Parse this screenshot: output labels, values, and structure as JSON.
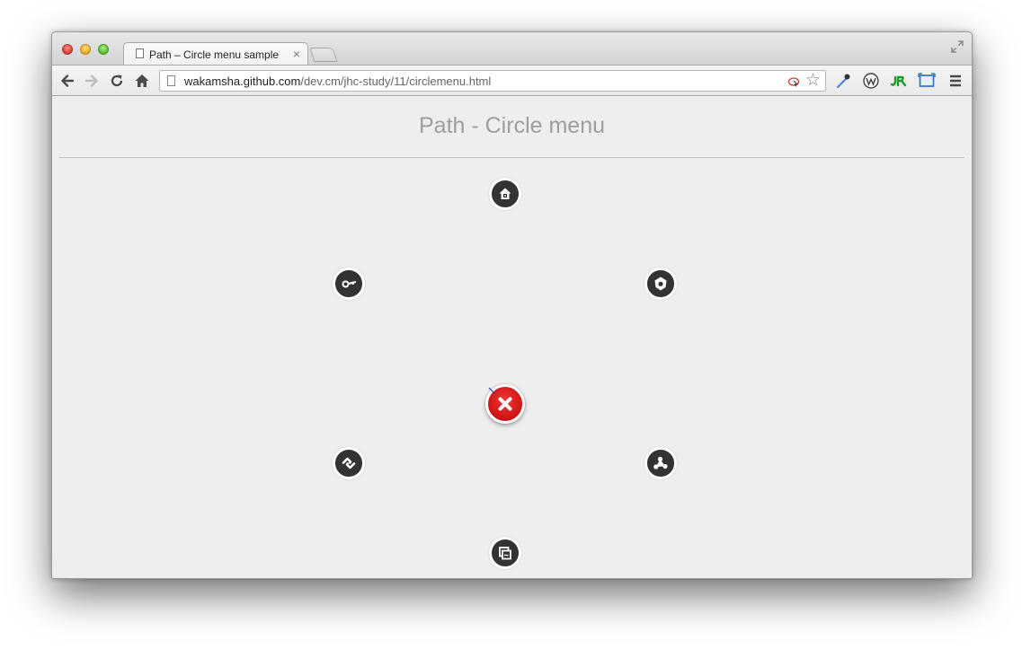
{
  "browser": {
    "tab": {
      "title": "Path – Circle menu sample",
      "close_glyph": "×"
    },
    "address_bar": {
      "host": "wakamsha.github.com",
      "path": "/dev.cm/jhc-study/11/circlemenu.html"
    },
    "star_glyph": "☆",
    "extension_icons": [
      "eyedropper-icon",
      "wordpress-icon",
      "jr-icon",
      "screen-capture-icon"
    ]
  },
  "page": {
    "title": "Path - Circle menu",
    "menu_items": [
      {
        "icon": "home-icon"
      },
      {
        "icon": "key-icon"
      },
      {
        "icon": "settings-icon"
      },
      {
        "icon": "link-icon"
      },
      {
        "icon": "nodes-icon"
      },
      {
        "icon": "copy-icon"
      }
    ],
    "center_button": {
      "icon": "close-icon",
      "color": "#d41c1c"
    }
  },
  "colors": {
    "menu_item_bg": "#333333",
    "page_bg": "#eeeeee",
    "title_text": "#9e9e9e",
    "accent_red": "#d41c1c"
  }
}
